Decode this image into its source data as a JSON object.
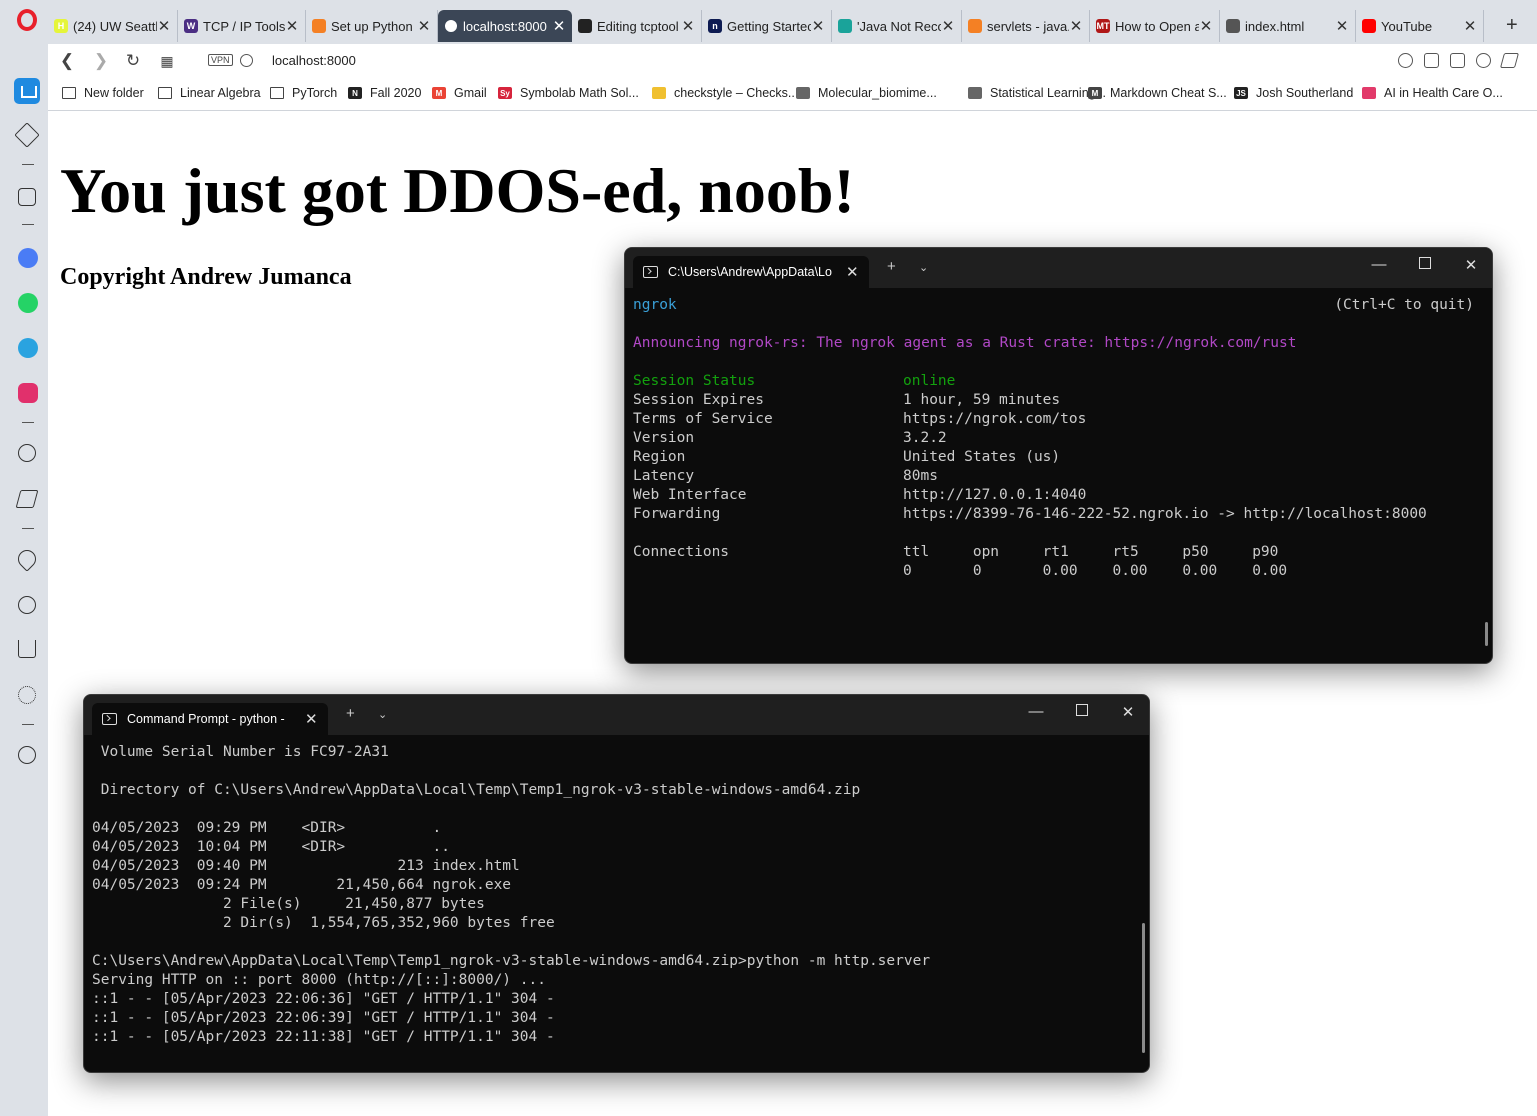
{
  "browser": {
    "tabs": [
      {
        "label": "(24) UW Seattl",
        "color": "#e5f53a",
        "glyph": "H",
        "active": false
      },
      {
        "label": "TCP / IP Tools",
        "color": "#4b2e83",
        "glyph": "W",
        "active": false
      },
      {
        "label": "Set up Python",
        "color": "#f48024",
        "glyph": "",
        "active": false
      },
      {
        "label": "localhost:8000",
        "color": "#ffffff",
        "glyph": "",
        "active": true
      },
      {
        "label": "Editing tcptool",
        "color": "#222222",
        "glyph": "",
        "active": false
      },
      {
        "label": "Getting Startec",
        "color": "#0d1b52",
        "glyph": "n",
        "active": false
      },
      {
        "label": "'Java Not Reco",
        "color": "#1aa39a",
        "glyph": "",
        "active": false
      },
      {
        "label": "servlets - java.",
        "color": "#f48024",
        "glyph": "",
        "active": false
      },
      {
        "label": "How to Open a",
        "color": "#b01717",
        "glyph": "MT",
        "active": false
      },
      {
        "label": "index.html",
        "color": "#555555",
        "glyph": "",
        "active": false
      },
      {
        "label": "YouTube",
        "color": "#ff0000",
        "glyph": "",
        "active": false
      }
    ],
    "address": {
      "vpn_label": "VPN",
      "url": "localhost:8000"
    },
    "bookmarks": [
      {
        "label": "New folder",
        "kind": "folder"
      },
      {
        "label": "Linear Algebra",
        "kind": "folder"
      },
      {
        "label": "PyTorch",
        "kind": "folder"
      },
      {
        "label": "Fall 2020",
        "kind": "notion"
      },
      {
        "label": "Gmail",
        "kind": "gmail"
      },
      {
        "label": "Symbolab Math Sol...",
        "kind": "symbolab"
      },
      {
        "label": "checkstyle – Checks...",
        "kind": "check"
      },
      {
        "label": "Molecular_biomime...",
        "kind": "doc"
      },
      {
        "label": "Statistical Learning...",
        "kind": "doc"
      },
      {
        "label": "Markdown Cheat S...",
        "kind": "md"
      },
      {
        "label": "Josh Southerland",
        "kind": "js"
      },
      {
        "label": "AI in Health Care O...",
        "kind": "ai"
      }
    ]
  },
  "page": {
    "heading": "You just got DDOS-ed, noob!",
    "subheading": "Copyright Andrew Jumanca"
  },
  "ngrok_terminal": {
    "tab_title": "C:\\Users\\Andrew\\AppData\\Lo",
    "lines": [
      {
        "a": "ngrok",
        "b": "(Ctrl+C to quit)",
        "style": "head"
      },
      {
        "a": "",
        "b": "",
        "style": "blank"
      },
      {
        "a": "Announcing ngrok-rs: The ngrok agent as a Rust crate: https://ngrok.com/rust",
        "b": "",
        "style": "magenta"
      },
      {
        "a": "",
        "b": "",
        "style": "blank"
      },
      {
        "a": "Session Status",
        "b": "online",
        "style": "green"
      },
      {
        "a": "Session Expires",
        "b": "1 hour, 59 minutes",
        "style": "kv"
      },
      {
        "a": "Terms of Service",
        "b": "https://ngrok.com/tos",
        "style": "kv"
      },
      {
        "a": "Version",
        "b": "3.2.2",
        "style": "kv"
      },
      {
        "a": "Region",
        "b": "United States (us)",
        "style": "kv"
      },
      {
        "a": "Latency",
        "b": "80ms",
        "style": "kv"
      },
      {
        "a": "Web Interface",
        "b": "http://127.0.0.1:4040",
        "style": "kv"
      },
      {
        "a": "Forwarding",
        "b": "https://8399-76-146-222-52.ngrok.io -> http://localhost:8000",
        "style": "kv"
      },
      {
        "a": "",
        "b": "",
        "style": "blank"
      },
      {
        "a": "Connections",
        "b": "ttl     opn     rt1     rt5     p50     p90",
        "style": "kv"
      },
      {
        "a": "",
        "b": "0       0       0.00    0.00    0.00    0.00",
        "style": "kv"
      }
    ]
  },
  "cmd_terminal": {
    "tab_title": "Command Prompt - python  -",
    "lines": [
      " Volume Serial Number is FC97-2A31",
      "",
      " Directory of C:\\Users\\Andrew\\AppData\\Local\\Temp\\Temp1_ngrok-v3-stable-windows-amd64.zip",
      "",
      "04/05/2023  09:29 PM    <DIR>          .",
      "04/05/2023  10:04 PM    <DIR>          ..",
      "04/05/2023  09:40 PM               213 index.html",
      "04/05/2023  09:24 PM        21,450,664 ngrok.exe",
      "               2 File(s)     21,450,877 bytes",
      "               2 Dir(s)  1,554,765,352,960 bytes free",
      "",
      "C:\\Users\\Andrew\\AppData\\Local\\Temp\\Temp1_ngrok-v3-stable-windows-amd64.zip>python -m http.server",
      "Serving HTTP on :: port 8000 (http://[::]:8000/) ...",
      "::1 - - [05/Apr/2023 22:06:36] \"GET / HTTP/1.1\" 304 -",
      "::1 - - [05/Apr/2023 22:06:39] \"GET / HTTP/1.1\" 304 -",
      "::1 - - [05/Apr/2023 22:11:38] \"GET / HTTP/1.1\" 304 -"
    ]
  }
}
